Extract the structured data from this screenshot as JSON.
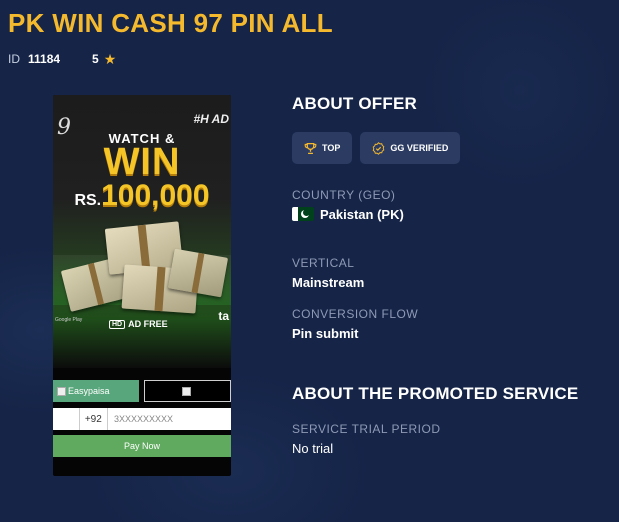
{
  "offer": {
    "title": "PK WIN CASH 97 PIN ALL",
    "id_label": "ID",
    "id_value": "11184",
    "rating": "5"
  },
  "creative": {
    "watch": "WATCH &",
    "win": "WIN",
    "currency": "RS.",
    "amount": "100,000",
    "tag": "#H AD",
    "hd": "HD",
    "ad_free": "AD FREE",
    "brand_partial": "ta",
    "gp_text": "Google Play",
    "easypaisa": "Easypaisa",
    "phone_code": "+92",
    "phone_placeholder": "3XXXXXXXXX",
    "pay_now": "Pay Now"
  },
  "about_offer": {
    "heading": "ABOUT OFFER",
    "badges": [
      "TOP",
      "GG VERIFIED"
    ],
    "country_label": "COUNTRY (GEO)",
    "country_value": "Pakistan (PK)",
    "vertical_label": "VERTICAL",
    "vertical_value": "Mainstream",
    "flow_label": "CONVERSION FLOW",
    "flow_value": "Pin submit"
  },
  "promoted": {
    "heading": "ABOUT THE PROMOTED SERVICE",
    "trial_label": "SERVICE TRIAL PERIOD",
    "trial_value": "No trial"
  },
  "colors": {
    "background": "#152447",
    "title": "#f5b92e",
    "badge_bg": "#2b3b62",
    "label": "#8f9ab5"
  }
}
